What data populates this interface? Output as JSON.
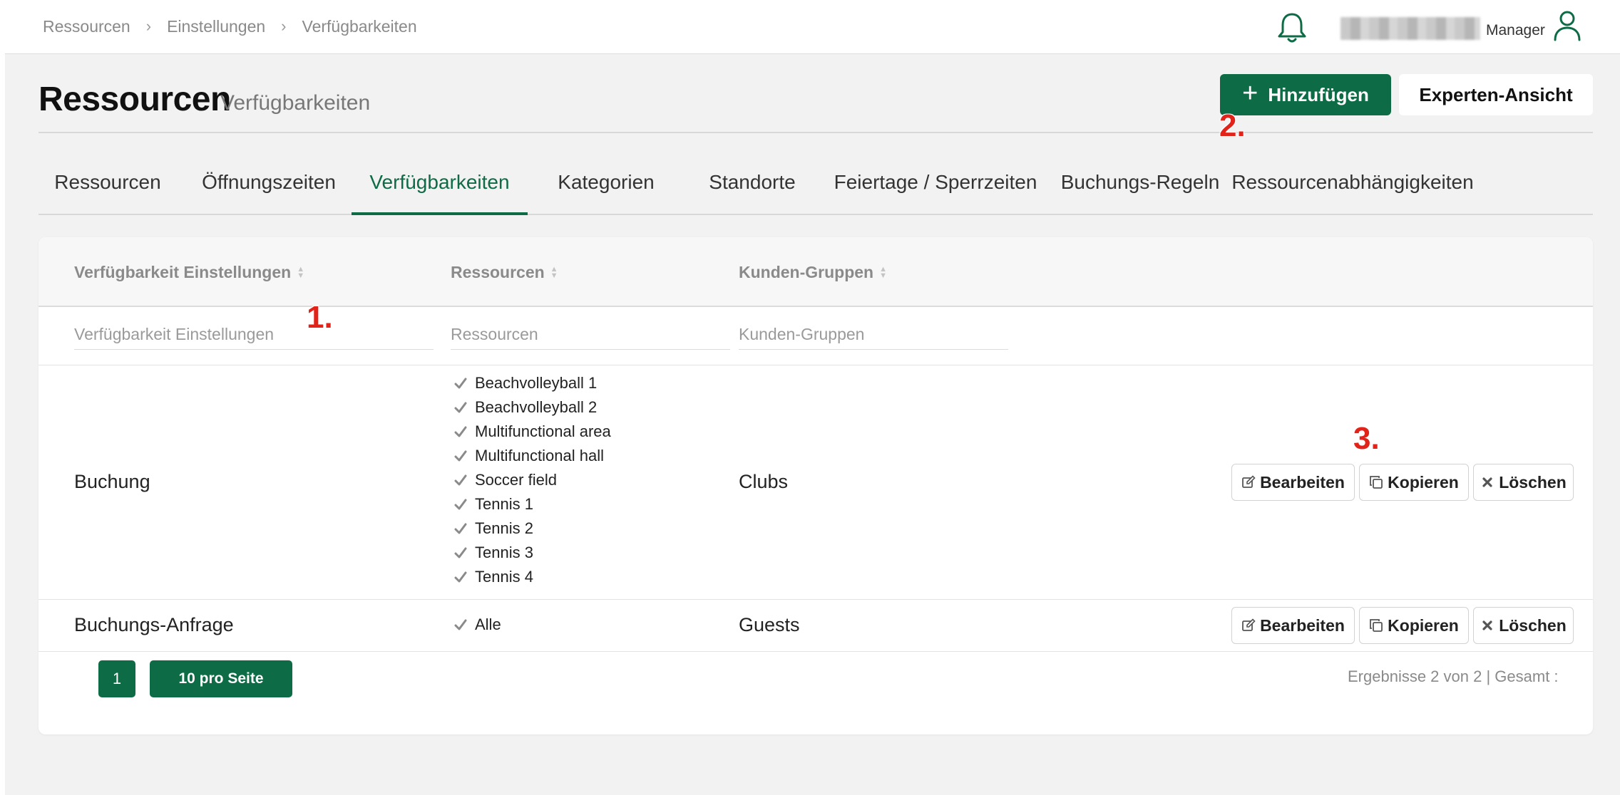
{
  "breadcrumb": [
    "Ressourcen",
    "Einstellungen",
    "Verfügbarkeiten"
  ],
  "user": {
    "role": "Manager"
  },
  "header": {
    "title": "Ressourcen",
    "subtitle": "Verfügbarkeiten",
    "add_label": "Hinzufügen",
    "expert_label": "Experten-Ansicht"
  },
  "annotations": [
    "1.",
    "2.",
    "3."
  ],
  "tabs": [
    "Ressourcen",
    "Öffnungszeiten",
    "Verfügbarkeiten",
    "Kategorien",
    "Standorte",
    "Feiertage / Sperrzeiten",
    "Buchungs-Regeln",
    "Ressourcenabhängigkeiten"
  ],
  "active_tab": "Verfügbarkeiten",
  "table": {
    "columns": [
      "Verfügbarkeit Einstellungen",
      "Ressourcen",
      "Kunden-Gruppen"
    ],
    "filters": [
      "Verfügbarkeit Einstellungen",
      "Ressourcen",
      "Kunden-Gruppen"
    ],
    "rows": [
      {
        "name": "Buchung",
        "resources": [
          "Beachvolleyball 1",
          "Beachvolleyball 2",
          "Multifunctional area",
          "Multifunctional hall",
          "Soccer field",
          "Tennis 1",
          "Tennis 2",
          "Tennis 3",
          "Tennis 4"
        ],
        "group": "Clubs"
      },
      {
        "name": "Buchungs-Anfrage",
        "resources": [
          "Alle"
        ],
        "group": "Guests"
      }
    ],
    "actions": {
      "edit": "Bearbeiten",
      "copy": "Kopieren",
      "delete": "Löschen"
    }
  },
  "pagination": {
    "page": "1",
    "page_size": "10 pro Seite",
    "results": "Ergebnisse 2 von 2 | Gesamt :"
  },
  "colors": {
    "primary": "#0d6b46",
    "annotation": "#e2231a"
  }
}
